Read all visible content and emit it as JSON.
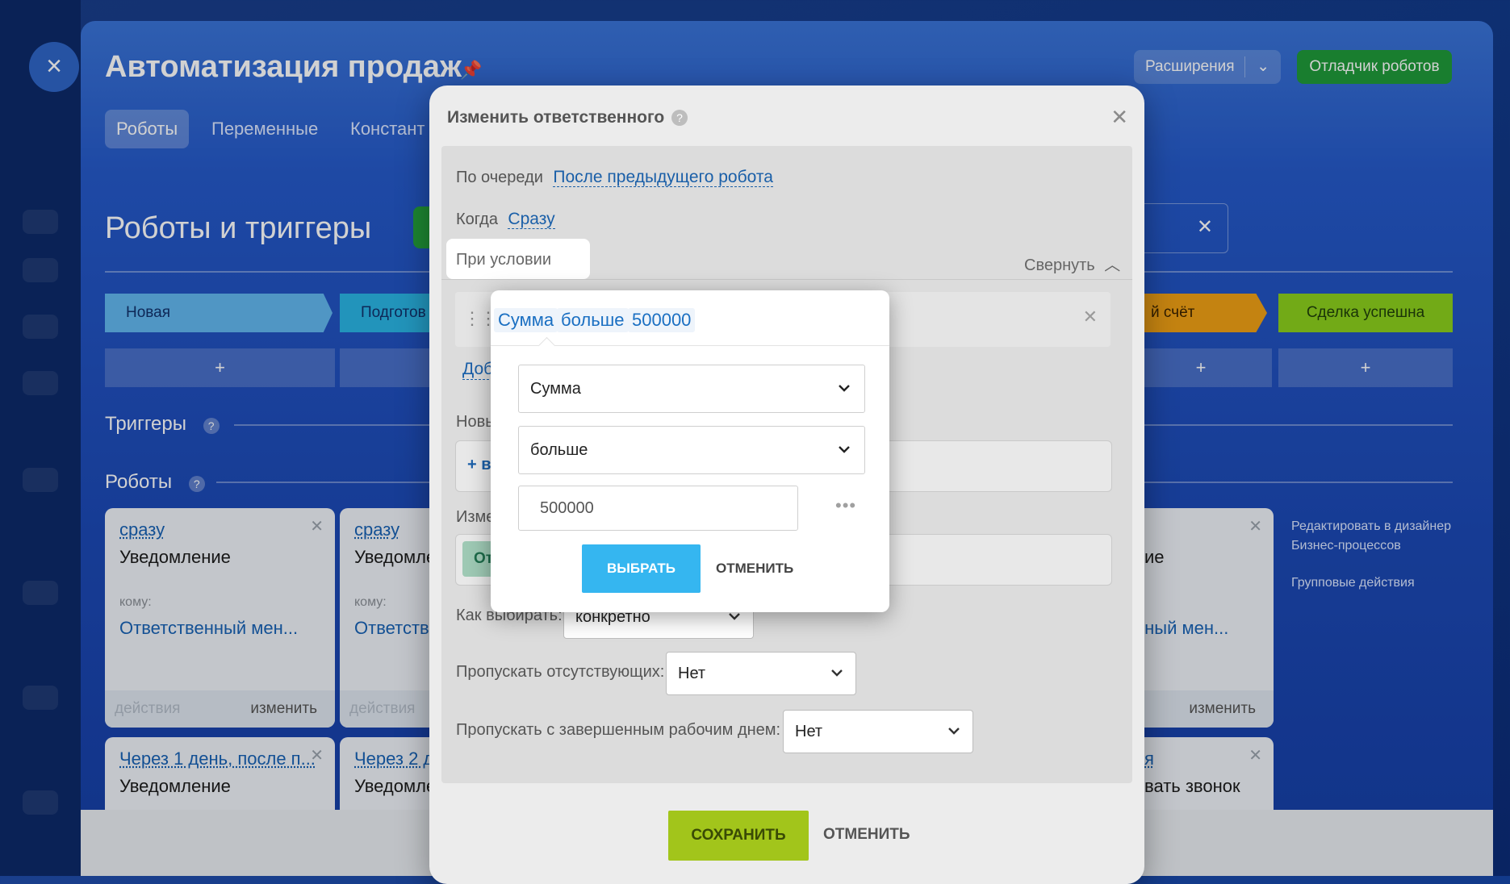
{
  "background": {
    "page_title": "Автоматизация продаж",
    "buttons": {
      "extensions": "Расширения",
      "robot_debugger": "Отладчик роботов"
    },
    "tabs": [
      "Роботы",
      "Переменные",
      "Констант"
    ],
    "section_title": "Роботы и триггеры",
    "stages": [
      "Новая",
      "Подготов",
      "й счёт",
      "Сделка успешна"
    ],
    "add_symbol": "+",
    "triggers_heading": "Триггеры",
    "robots_heading": "Роботы",
    "cards": [
      {
        "when": "сразу",
        "title": "Уведомление",
        "to_label": "кому:",
        "to_value": "Ответственный мен...",
        "actions": "действия",
        "change": "изменить"
      },
      {
        "when": "сразу",
        "title": "Уведомле",
        "to_label": "кому:",
        "to_value": "Ответстве",
        "actions": "действия"
      },
      {
        "title": "ие",
        "to_value": "нный мен...",
        "change": "изменить"
      }
    ],
    "cards_row2": [
      {
        "when": "Через 1 день, после п...",
        "title": "Уведомление"
      },
      {
        "when": "Через 2 д",
        "title": "Уведомле"
      },
      {
        "when": "я",
        "title": "вать звонок"
      }
    ],
    "side_links": [
      "Редактировать в дизайнер",
      "Бизнес-процессов",
      "Групповые действия"
    ]
  },
  "modal": {
    "title": "Изменить ответственного",
    "order_label": "По очереди",
    "order_value": "После предыдущего робота",
    "when_label": "Когда",
    "when_value": "Сразу",
    "condition_label": "При условии",
    "collapse_label": "Свернуть",
    "add_partial": "Доб",
    "new_partial": "Новы",
    "add_btn_partial": "+ в",
    "change_partial": "Изме",
    "green_partial": "От",
    "how_label": "Как выбирать:",
    "how_value": "конкретно",
    "skip_absent_label": "Пропускать отсутствующих:",
    "skip_absent_value": "Нет",
    "skip_finished_label": "Пропускать с завершенным рабочим днем:",
    "skip_finished_value": "Нет",
    "save": "СОХРАНИТЬ",
    "cancel": "ОТМЕНИТЬ"
  },
  "popup": {
    "chips": [
      "Сумма",
      "больше",
      "500000"
    ],
    "field_select": "Сумма",
    "operator_select": "больше",
    "value_input": "500000",
    "choose": "ВЫБРАТЬ",
    "cancel": "ОТМЕНИТЬ"
  }
}
